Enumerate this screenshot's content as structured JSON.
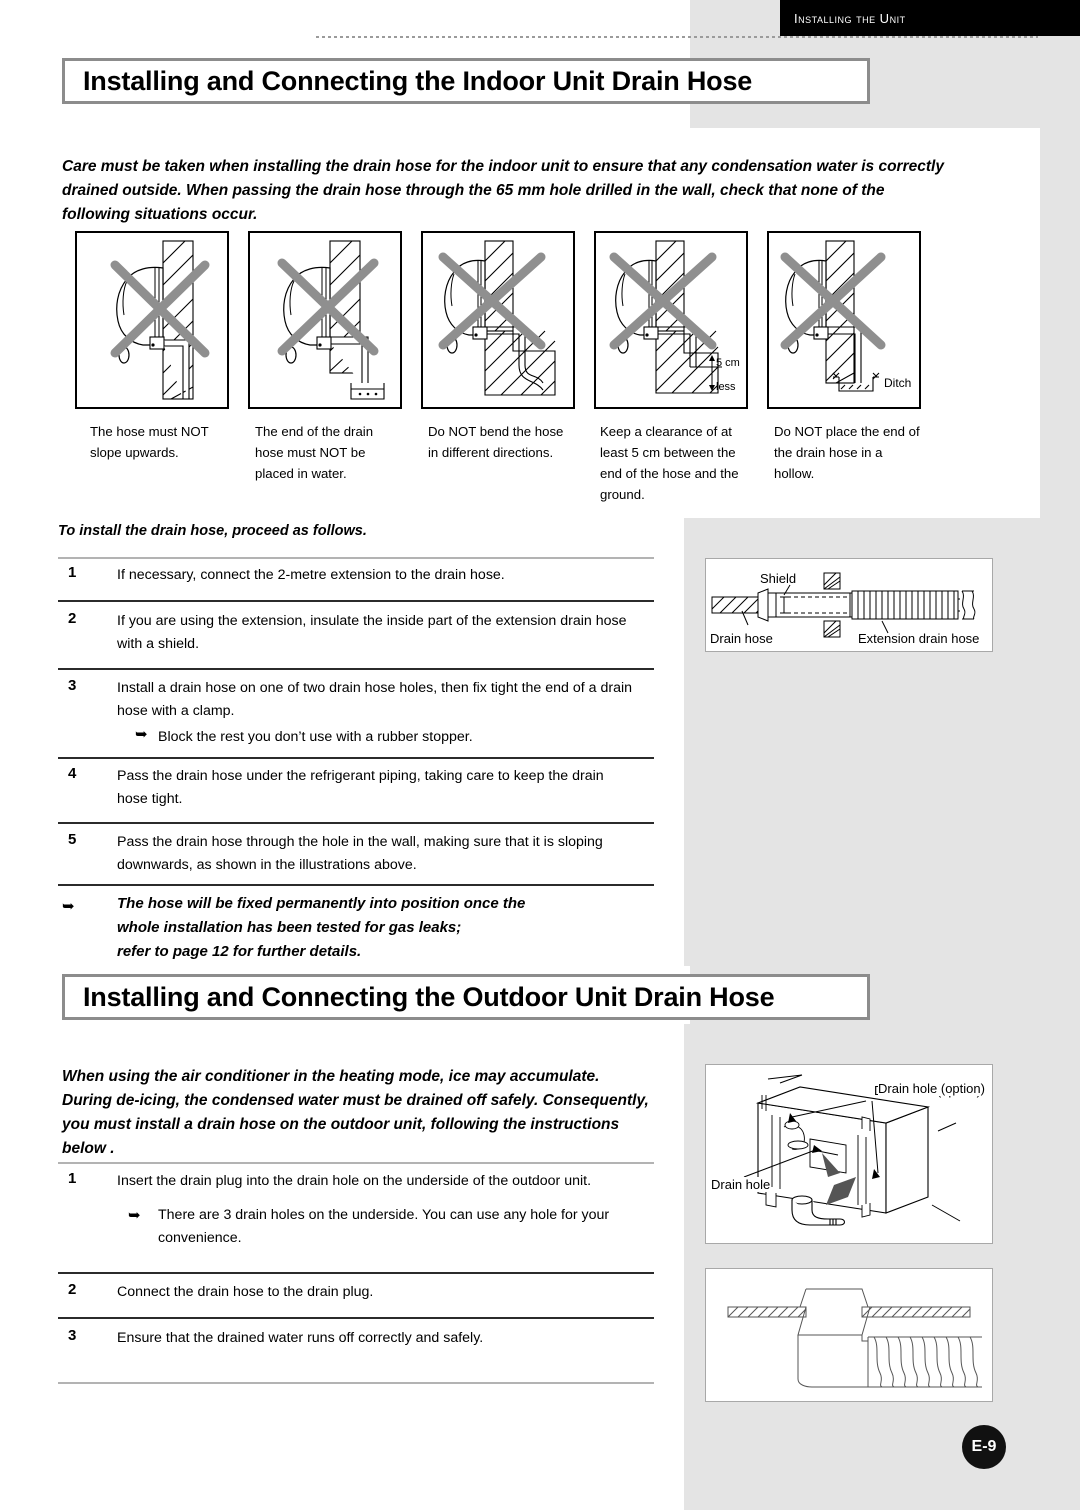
{
  "running_head": {
    "text": "Installing the Unit"
  },
  "page_number": "E-9",
  "section1": {
    "title": "Installing and Connecting the Indoor Unit Drain Hose",
    "intro": "Care must be taken when installing the drain hose for the indoor unit to ensure that any condensation water is correctly drained outside. When passing the drain hose through the 65 mm hole drilled in the wall, check that none of the following situations occur.",
    "panels": [
      {
        "name": "hose-slope-upwards",
        "caption": "The hose must NOT slope upwards.",
        "labels": []
      },
      {
        "name": "hose-end-in-water",
        "caption": "The end of the drain hose must NOT be placed in water.",
        "labels": []
      },
      {
        "name": "hose-bent-directions",
        "caption": "Do NOT bend the hose in different directions.",
        "labels": []
      },
      {
        "name": "hose-ground-clearance",
        "caption": "Keep a clearance of at least 5 cm between the end of the hose and the ground.",
        "labels": [
          "5 cm",
          "less"
        ]
      },
      {
        "name": "hose-end-in-hollow",
        "caption": "Do NOT place the end of the drain hose in a hollow.",
        "labels": [
          "Ditch"
        ]
      }
    ],
    "procedure_heading": "To install the drain hose, proceed as follows.",
    "steps": [
      {
        "num": "1",
        "text": "If necessary, connect the 2-metre extension to the drain hose.",
        "sub": []
      },
      {
        "num": "2",
        "text": "If you are using the extension, insulate the inside part of the extension drain hose with a shield.",
        "sub": []
      },
      {
        "num": "3",
        "text": "Install a drain hose on one of two drain hose holes, then fix tight the end of a drain hose with a clamp.",
        "sub": [
          "Block the rest you don’t use with a rubber stopper."
        ]
      },
      {
        "num": "4",
        "text": "Pass the drain hose under the refrigerant piping, taking care to keep the drain hose tight.",
        "sub": []
      },
      {
        "num": "5",
        "text": "Pass the drain hose through the hole in the wall, making sure that it is sloping downwards, as shown in the illustrations above.",
        "sub": []
      }
    ],
    "final_note": {
      "line1": "The hose will be fixed permanently into position once the",
      "line2": "whole installation has been tested for gas leaks;",
      "line3": "refer to page 12 for further details."
    },
    "shield_diagram": {
      "name": "shield-extension-hose-diagram",
      "labels": {
        "shield": "Shield",
        "drain_hose": "Drain hose",
        "extension": "Extension drain hose"
      }
    }
  },
  "section2": {
    "title": "Installing and Connecting the Outdoor Unit Drain Hose",
    "intro": "When using the air conditioner in the heating mode, ice may accumulate. During de-icing, the condensed water must be drained off safely. Consequently, you must install a drain hose on the outdoor unit, following the instructions below .",
    "steps": [
      {
        "num": "1",
        "text": "Insert the drain plug into the drain hole on the underside of the outdoor unit.",
        "sub": [
          "There are 3 drain holes on the underside. You can use any hole for your convenience."
        ]
      },
      {
        "num": "2",
        "text": "Connect the drain hose to the drain plug.",
        "sub": []
      },
      {
        "num": "3",
        "text": "Ensure that the drained water runs off correctly and safely.",
        "sub": []
      }
    ],
    "outdoor_diagram": {
      "name": "outdoor-unit-drain-holes-diagram",
      "labels": {
        "drain_hole_option": "Drain hole (option)",
        "drain_hole": "Drain hole"
      }
    },
    "plug_diagram": {
      "name": "drain-plug-cross-section-diagram",
      "labels": {}
    }
  },
  "colors": {
    "grey_plate": "#e4e4e4",
    "title_border": "#8c8c8c",
    "rule_light": "#b3b3b3",
    "rule_dark": "#2b2b2b",
    "cross_mark": "#8f8f8f",
    "runhead_bg": "#000000"
  }
}
